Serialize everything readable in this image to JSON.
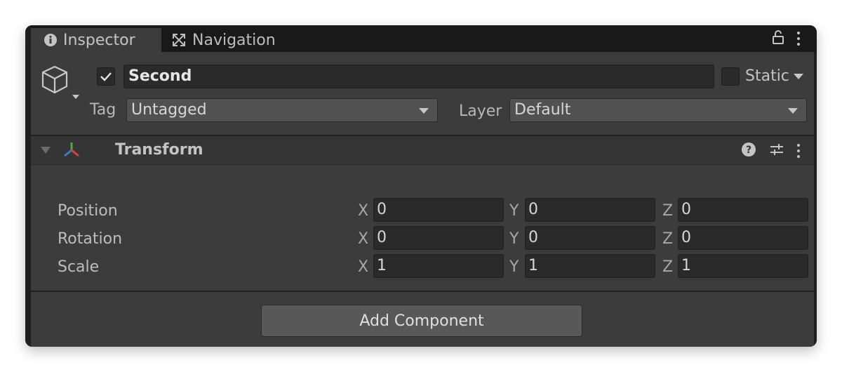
{
  "tabs": [
    {
      "label": "Inspector",
      "icon": "info-icon"
    },
    {
      "label": "Navigation",
      "icon": "navigation-icon"
    }
  ],
  "header": {
    "active_checked": true,
    "object_name": "Second",
    "static_checked": false,
    "static_label": "Static",
    "tag_label": "Tag",
    "tag_value": "Untagged",
    "layer_label": "Layer",
    "layer_value": "Default"
  },
  "component": {
    "title": "Transform",
    "rows": [
      {
        "label": "Position",
        "x": "0",
        "y": "0",
        "z": "0"
      },
      {
        "label": "Rotation",
        "x": "0",
        "y": "0",
        "z": "0"
      },
      {
        "label": "Scale",
        "x": "1",
        "y": "1",
        "z": "1"
      }
    ],
    "axis_labels": {
      "x": "X",
      "y": "Y",
      "z": "Z"
    }
  },
  "add_component_label": "Add Component",
  "colors": {
    "background": "#282828",
    "panel": "#3c3c3c",
    "field": "#2a2a2a",
    "text": "#c4c4c4"
  }
}
